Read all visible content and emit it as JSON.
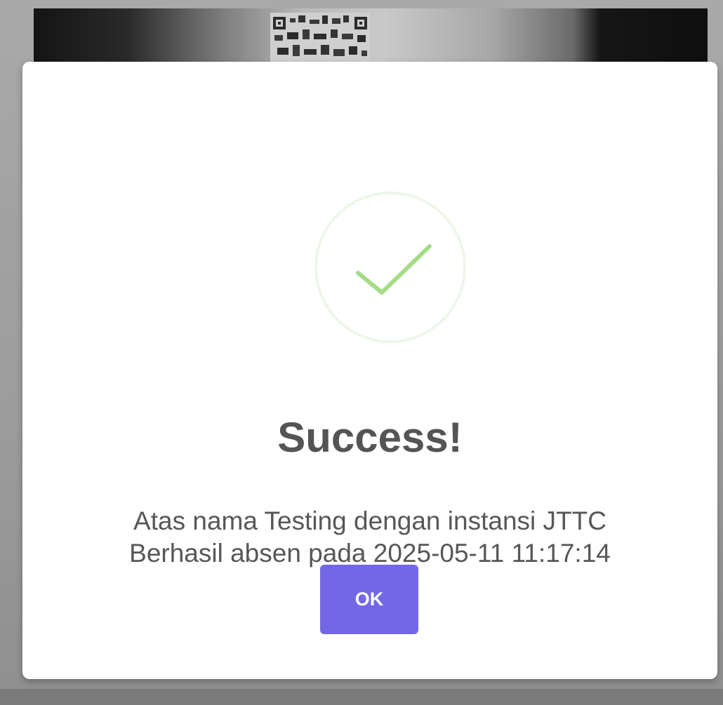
{
  "dialog": {
    "title": "Success!",
    "message_line1": "Atas nama Testing dengan instansi JTTC",
    "message_line2": "Berhasil absen pada 2025-05-11 11:17:14",
    "confirm_label": "OK",
    "icon": "check-icon"
  },
  "colors": {
    "confirm_button": "#7367e6",
    "check_mark": "#a5dc86",
    "check_ring": "#eef6e9",
    "title_text": "#545454"
  }
}
